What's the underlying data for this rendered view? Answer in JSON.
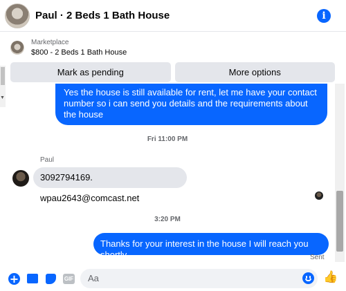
{
  "header": {
    "title": "Paul · 2 Beds 1 Bath House",
    "info_icon": "i"
  },
  "marketplace": {
    "kicker": "Marketplace",
    "item": "$800 - 2 Beds 1 Bath House"
  },
  "actions": {
    "pending": "Mark as pending",
    "more": "More options"
  },
  "messages": {
    "out1": "Yes the house is still available for rent, let me have your contact number so i can send you details and the requirements about the house",
    "time1": "Fri 11:00 PM",
    "sender": "Paul",
    "in1": "3092794169. wpau2643@comcast.net",
    "time2": "3:20 PM",
    "out2": "Thanks for your interest in the house I will reach you shortly",
    "status": "Sent"
  },
  "composer": {
    "placeholder": "Aa",
    "gif": "GIF",
    "plus": "+",
    "like": "👍"
  },
  "colors": {
    "accent": "#0866ff",
    "bubble_in": "#e4e6eb"
  }
}
